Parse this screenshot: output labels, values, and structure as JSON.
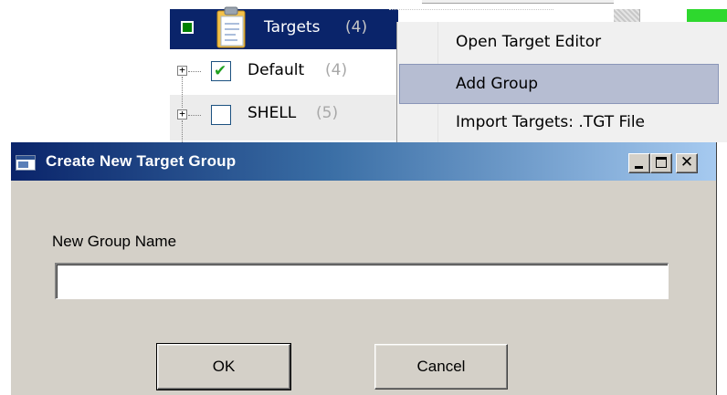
{
  "tree": {
    "root": {
      "label": "Targets",
      "count": "(4)",
      "selected": true
    },
    "items": [
      {
        "label": "Default",
        "count": "(4)",
        "checked": true
      },
      {
        "label": "SHELL",
        "count": "(5)",
        "checked": false
      }
    ]
  },
  "context_menu": {
    "items": [
      {
        "label": "Open Target Editor",
        "highlighted": false
      },
      {
        "label": "Add Group",
        "highlighted": true
      },
      {
        "label": "Import Targets: .TGT File",
        "highlighted": false
      }
    ]
  },
  "dialog": {
    "title": "Create New Target Group",
    "caption_buttons": {
      "minimize_icon": "minimize-icon",
      "maximize_icon": "maximize-icon",
      "close_icon": "close-icon",
      "close_glyph": "✕"
    },
    "field_label": "New Group Name",
    "field_value": "",
    "field_placeholder": "",
    "ok_label": "OK",
    "cancel_label": "Cancel"
  },
  "colors": {
    "selection": "#0a246a",
    "menu_highlight": "#b6bdd2",
    "dialog_face": "#d4d0c8",
    "checkmark": "#21a121"
  }
}
